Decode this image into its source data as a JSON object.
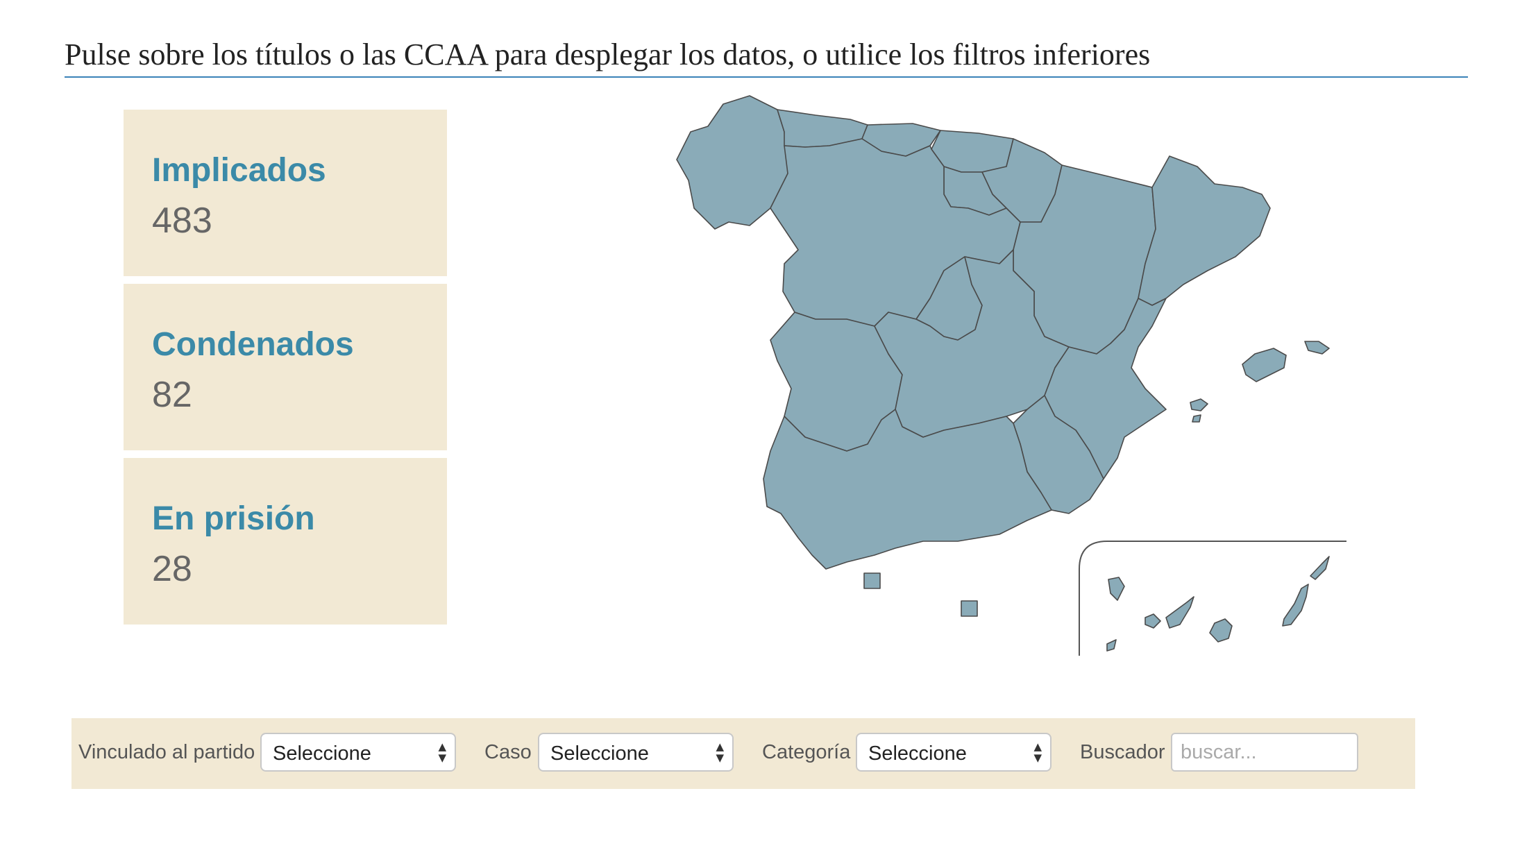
{
  "instructions": "Pulse sobre los títulos o las CCAA para desplegar los datos, o utilice los filtros inferiores",
  "stats": [
    {
      "label": "Implicados",
      "value": "483"
    },
    {
      "label": "Condenados",
      "value": "82"
    },
    {
      "label": "En prisión",
      "value": "28"
    }
  ],
  "filters": {
    "partido": {
      "label": "Vinculado al partido",
      "selected": "Seleccione"
    },
    "caso": {
      "label": "Caso",
      "selected": "Seleccione"
    },
    "categoria": {
      "label": "Categoría",
      "selected": "Seleccione"
    },
    "buscador": {
      "label": "Buscador",
      "placeholder": "buscar..."
    }
  },
  "colors": {
    "accent": "#3b8aa8",
    "panel": "#f2e9d4",
    "region": "#8aabb8",
    "rule": "#3a82b8"
  }
}
